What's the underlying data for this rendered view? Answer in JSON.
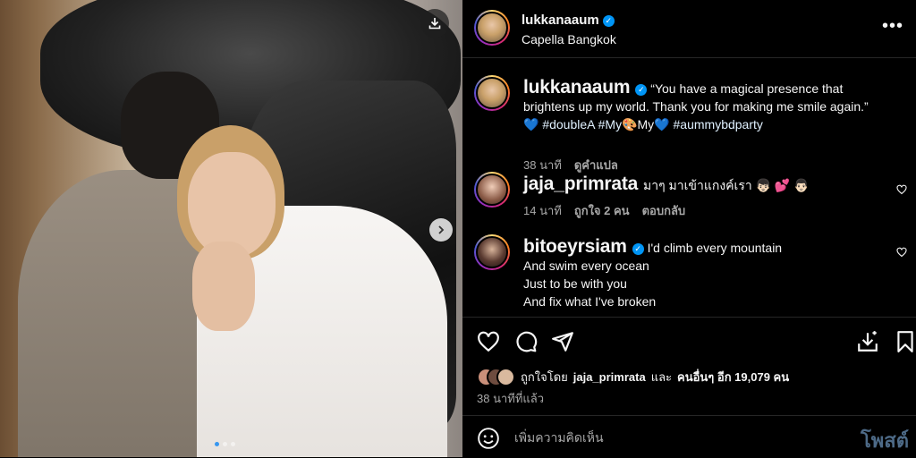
{
  "post": {
    "username": "lukkanaaum",
    "location": "Capella Bangkok",
    "more_icon": "more-horizontal-icon"
  },
  "caption": {
    "username": "lukkanaaum",
    "text_1": "“You have a magical presence that brightens up my world. Thank you for making me smile again.”",
    "emoji_1": "💙",
    "tag_1": "#doubleA",
    "tag_2": "#My",
    "emoji_2": "🎨",
    "tag_2_tail": "My",
    "emoji_3": "💙",
    "tag_3": "#aummybdparty",
    "time": "38 นาที",
    "translate": "ดูคำแปล"
  },
  "comments": [
    {
      "username": "jaja_primrata",
      "text": "มาๆ มาเข้าแกงค์เรา 👦🏻 💕 👨🏻",
      "time": "14 นาที",
      "likes": "ถูกใจ 2 คน",
      "reply": "ตอบกลับ"
    },
    {
      "username": "bitoeyrsiam",
      "lines": [
        "I'd climb every mountain",
        "And swim every ocean",
        "Just to be with you",
        "And fix what I've broken"
      ]
    }
  ],
  "likes": {
    "prefix": "ถูกใจโดย",
    "user": "jaja_primrata",
    "mid": "และ",
    "others": "คนอื่นๆ อีก 19,079 คน"
  },
  "time_ago": "38 นาทีที่แล้ว",
  "comment_box": {
    "placeholder": "เพิ่มความคิดเห็น",
    "post_label": "โพสต์"
  },
  "carousel": {
    "current": 1,
    "total": 3
  },
  "colors": {
    "accent": "#0095f6",
    "active_dot": "#3797f0"
  }
}
